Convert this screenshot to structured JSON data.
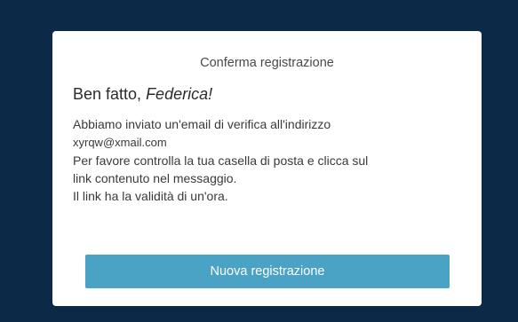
{
  "dialog": {
    "title": "Conferma registrazione",
    "greeting_prefix": "Ben fatto, ",
    "greeting_name": "Federica!",
    "message_line1": "Abbiamo inviato un'email di verifica all'indirizzo",
    "email": "xyrqw@xmail.com",
    "message_line2": "Per favore controlla la tua casella di posta e clicca sul",
    "message_line3": "link contenuto nel messaggio.",
    "message_line4": "Il link ha la validità di un'ora.",
    "button_label": "Nuova registrazione"
  },
  "colors": {
    "background": "#0c2a47",
    "card": "#ffffff",
    "button": "#4aa3c5",
    "button_text": "#ffffff"
  }
}
